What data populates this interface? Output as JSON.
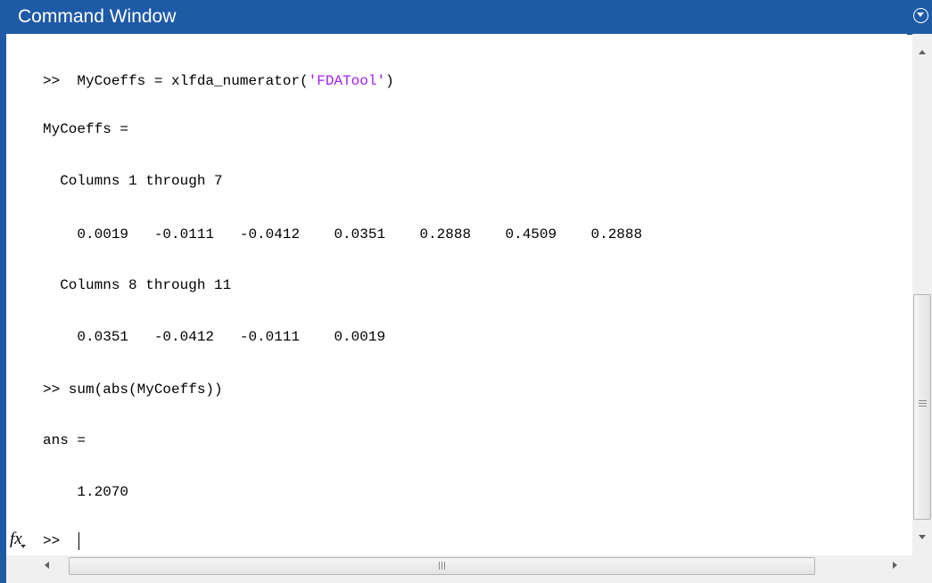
{
  "window": {
    "title": "Command Window"
  },
  "colors": {
    "titlebar": "#1e5aa6",
    "string": "#a020f0",
    "text": "#000000"
  },
  "console": {
    "lines": {
      "cmd1_prompt": ">>  MyCoeffs = xlfda_numerator(",
      "cmd1_string": "'FDATool'",
      "cmd1_end": ")",
      "var_assign": "MyCoeffs =",
      "cols_header_1": "  Columns 1 through 7",
      "row_1": "    0.0019   -0.0111   -0.0412    0.0351    0.2888    0.4509    0.2888",
      "cols_header_2": "  Columns 8 through 11",
      "row_2": "    0.0351   -0.0412   -0.0111    0.0019",
      "cmd2": ">> sum(abs(MyCoeffs))",
      "ans_assign": "ans =",
      "ans_value": "    1.2070"
    },
    "fx_label": "fx",
    "prompt": ">>"
  },
  "icons": {
    "window_menu": "circle-chevron-down-icon",
    "fx": "function-browser-icon",
    "scroll_up": "arrow-up-icon",
    "scroll_down": "arrow-down-icon",
    "scroll_left": "arrow-left-icon",
    "scroll_right": "arrow-right-icon"
  }
}
